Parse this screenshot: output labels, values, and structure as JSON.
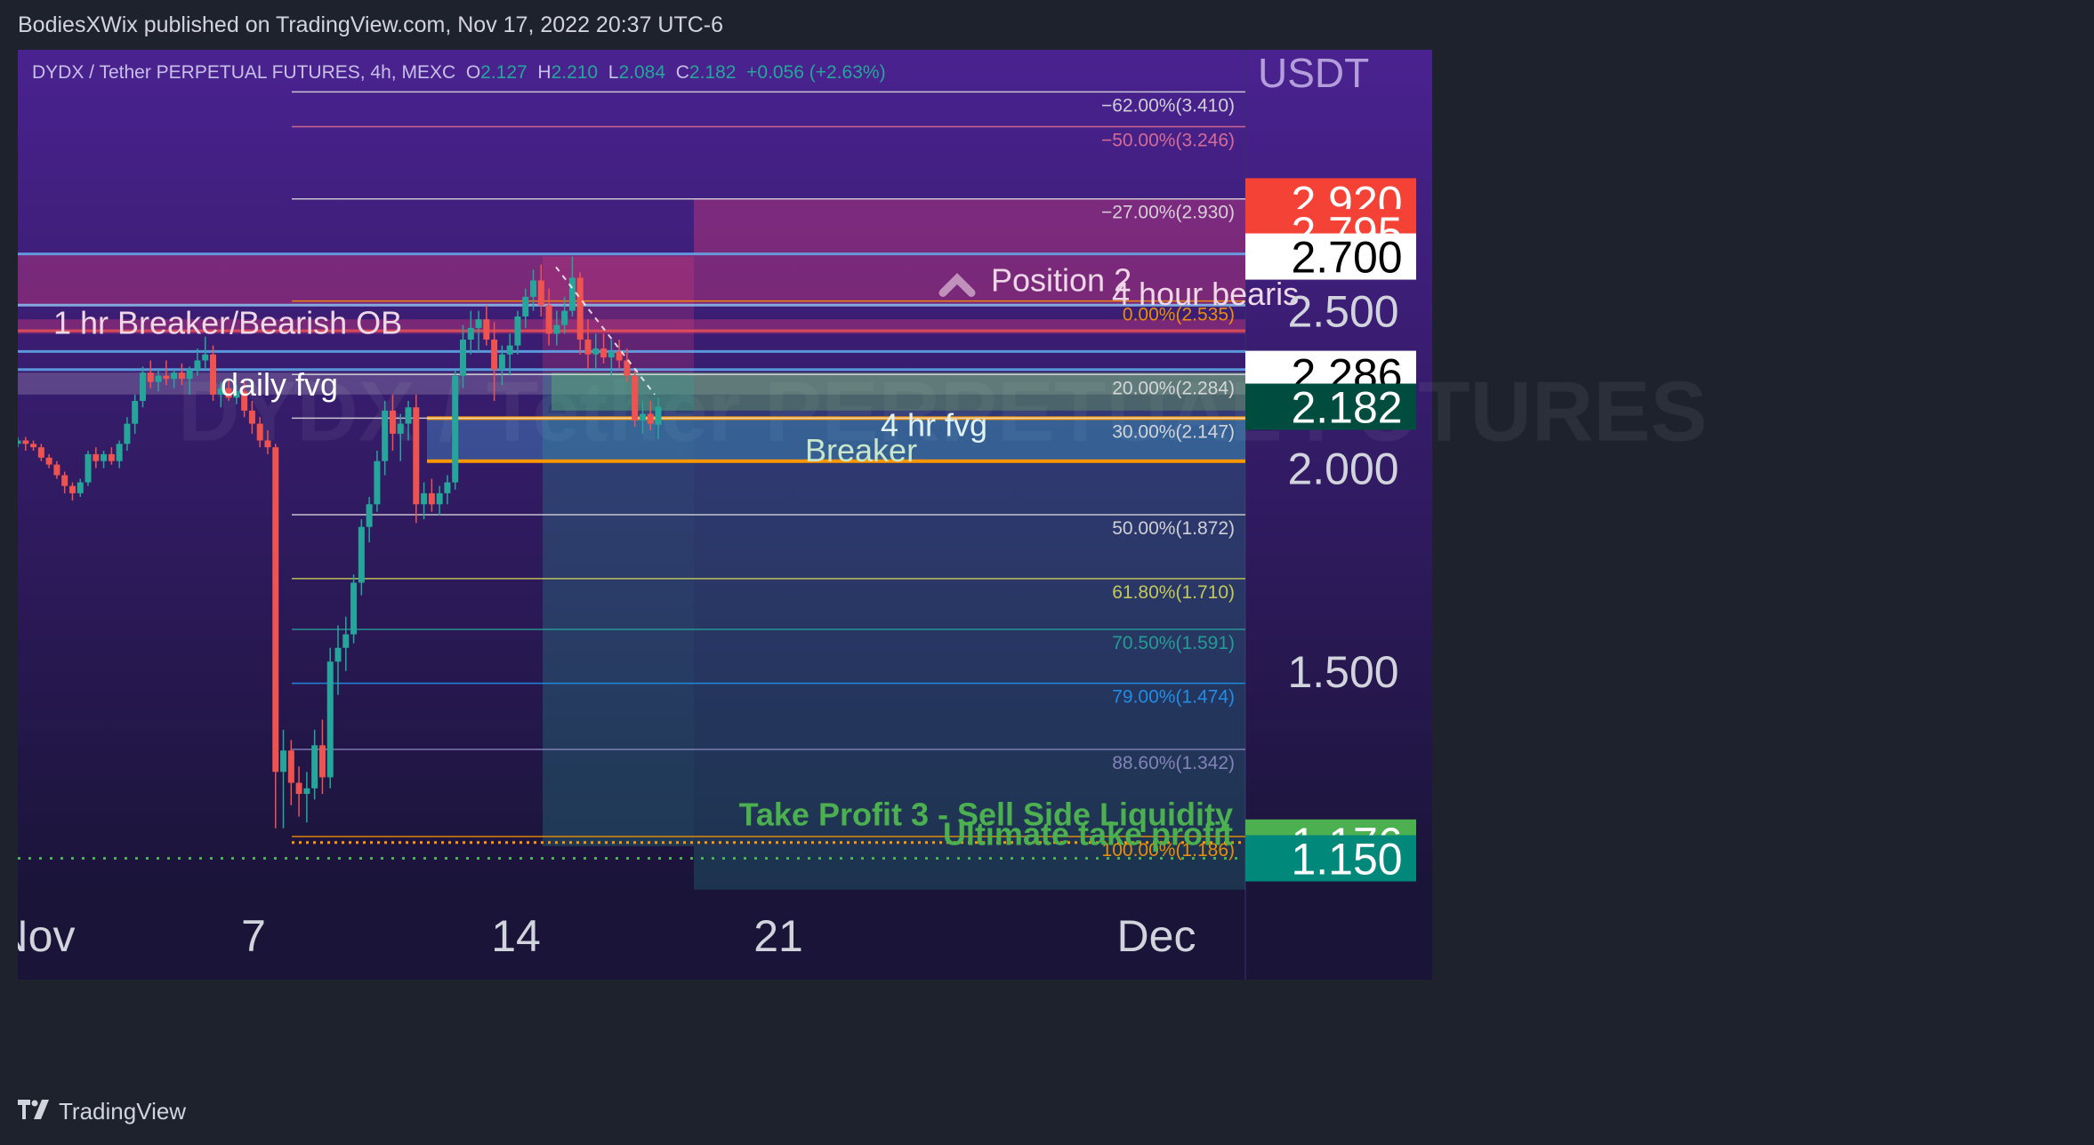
{
  "header": {
    "publisher": "BodiesXWix published on TradingView.com, Nov 17, 2022 20:37 UTC-6"
  },
  "symbol": {
    "name": "DYDX / Tether PERPETUAL FUTURES, 4h, MEXC",
    "o_label": "O",
    "o": "2.127",
    "h_label": "H",
    "h": "2.210",
    "l_label": "L",
    "l": "2.084",
    "c_label": "C",
    "c": "2.182",
    "change": "+0.056 (+2.63%)",
    "watermark": "DYDX / Tether PERPETUAL FUTURES"
  },
  "footer": {
    "brand": "TradingView",
    "logo": "tradingview-logo-icon"
  },
  "colors": {
    "background_top": "#4a2290",
    "background_bottom": "#1a1438",
    "up": "#26a69a",
    "down": "#ef5350",
    "fib_line": "#ffffff"
  },
  "chart_data": {
    "type": "candlestick",
    "currency_label": "USDT",
    "y_axis": {
      "scale": "log",
      "range": [
        1.09,
        3.62
      ],
      "tick_labels": [
        "2.500",
        "2.000",
        "1.500"
      ]
    },
    "x_axis": {
      "tick_labels": [
        "Nov",
        "7",
        "14",
        "21",
        "Dec"
      ]
    },
    "price_labels": [
      {
        "value": "2.920",
        "color": "#f44336",
        "text_color": "#ffffff"
      },
      {
        "value": "2.795",
        "color": "#f44336",
        "text_color": "#ffffff"
      },
      {
        "value": "2.700",
        "color": "#ffffff",
        "text_color": "#000000"
      },
      {
        "value": "2.286",
        "color": "#ffffff",
        "text_color": "#000000"
      },
      {
        "value": "2.182",
        "color": "#004d40",
        "text_color": "#ffffff"
      },
      {
        "value": "1.176",
        "color": "#4caf50",
        "text_color": "#ffffff"
      },
      {
        "value": "1.150",
        "color": "#00897b",
        "text_color": "#ffffff"
      }
    ],
    "fib_levels": [
      {
        "label": "−62.00%(3.410)",
        "price": 3.41,
        "color": "#e0e0e0"
      },
      {
        "label": "−50.00%(3.246)",
        "price": 3.246,
        "color": "#e57398"
      },
      {
        "label": "−27.00%(2.930)",
        "price": 2.93,
        "color": "#e0e0e0"
      },
      {
        "label": "0.00%(2.535)",
        "price": 2.535,
        "color": "#ff9800"
      },
      {
        "label": "20.00%(2.284)",
        "price": 2.284,
        "color": "#e0e0e0"
      },
      {
        "label": "30.00%(2.147)",
        "price": 2.147,
        "color": "#e0e0e0"
      },
      {
        "label": "50.00%(1.872)",
        "price": 1.872,
        "color": "#e0e0e0"
      },
      {
        "label": "61.80%(1.710)",
        "price": 1.71,
        "color": "#d4d85a"
      },
      {
        "label": "70.50%(1.591)",
        "price": 1.591,
        "color": "#26a69a"
      },
      {
        "label": "79.00%(1.474)",
        "price": 1.474,
        "color": "#2196f3"
      },
      {
        "label": "88.60%(1.342)",
        "price": 1.342,
        "color": "#8c8cbf"
      },
      {
        "label": "100.00%(1.186)",
        "price": 1.186,
        "color": "#ff9800"
      }
    ],
    "annotations": [
      {
        "text": "1 hr Breaker/Bearish OB",
        "color": "#f0d7e8"
      },
      {
        "text": "daily fvg",
        "color": "#ffffff"
      },
      {
        "text": "Position 2",
        "color": "#f0d7e8"
      },
      {
        "text": "4 hour bearis",
        "color": "#f0d7e8"
      },
      {
        "text": "4 hr fvg",
        "color": "#e0f2f1"
      },
      {
        "text": "Breaker",
        "color": "#c8e6c9"
      },
      {
        "text": "Take Profit 3 - Sell Side Liquidity",
        "color": "#4caf50"
      },
      {
        "text": "Ultimate take profit",
        "color": "#4caf50"
      }
    ],
    "candles": [
      [
        2.07,
        2.09,
        2.06,
        2.08
      ],
      [
        2.08,
        2.09,
        2.05,
        2.07
      ],
      [
        2.07,
        2.08,
        2.05,
        2.06
      ],
      [
        2.06,
        2.07,
        2.02,
        2.03
      ],
      [
        2.03,
        2.04,
        2.0,
        2.01
      ],
      [
        2.01,
        2.02,
        1.97,
        1.98
      ],
      [
        1.98,
        1.99,
        1.93,
        1.95
      ],
      [
        1.95,
        1.96,
        1.91,
        1.93
      ],
      [
        1.93,
        1.97,
        1.92,
        1.96
      ],
      [
        1.96,
        2.05,
        1.95,
        2.04
      ],
      [
        2.04,
        2.06,
        2.0,
        2.02
      ],
      [
        2.02,
        2.05,
        2.0,
        2.04
      ],
      [
        2.04,
        2.06,
        2.01,
        2.02
      ],
      [
        2.02,
        2.08,
        2.0,
        2.07
      ],
      [
        2.07,
        2.15,
        2.05,
        2.13
      ],
      [
        2.13,
        2.22,
        2.1,
        2.2
      ],
      [
        2.2,
        2.31,
        2.18,
        2.29
      ],
      [
        2.29,
        2.33,
        2.24,
        2.26
      ],
      [
        2.26,
        2.3,
        2.23,
        2.28
      ],
      [
        2.28,
        2.33,
        2.25,
        2.27
      ],
      [
        2.27,
        2.3,
        2.24,
        2.29
      ],
      [
        2.29,
        2.32,
        2.25,
        2.27
      ],
      [
        2.27,
        2.31,
        2.22,
        2.3
      ],
      [
        2.3,
        2.37,
        2.28,
        2.33
      ],
      [
        2.33,
        2.41,
        2.3,
        2.35
      ],
      [
        2.35,
        2.38,
        2.2,
        2.22
      ],
      [
        2.22,
        2.26,
        2.18,
        2.24
      ],
      [
        2.24,
        2.27,
        2.2,
        2.21
      ],
      [
        2.21,
        2.25,
        2.19,
        2.23
      ],
      [
        2.23,
        2.26,
        2.15,
        2.17
      ],
      [
        2.17,
        2.2,
        2.1,
        2.13
      ],
      [
        2.13,
        2.15,
        2.06,
        2.08
      ],
      [
        2.08,
        2.11,
        2.04,
        2.06
      ],
      [
        2.06,
        2.07,
        1.2,
        1.3
      ],
      [
        1.3,
        1.38,
        1.2,
        1.34
      ],
      [
        1.34,
        1.36,
        1.24,
        1.28
      ],
      [
        1.28,
        1.31,
        1.22,
        1.26
      ],
      [
        1.26,
        1.3,
        1.21,
        1.27
      ],
      [
        1.27,
        1.38,
        1.25,
        1.35
      ],
      [
        1.35,
        1.4,
        1.26,
        1.29
      ],
      [
        1.29,
        1.55,
        1.27,
        1.52
      ],
      [
        1.52,
        1.6,
        1.45,
        1.55
      ],
      [
        1.55,
        1.62,
        1.5,
        1.58
      ],
      [
        1.58,
        1.72,
        1.56,
        1.7
      ],
      [
        1.7,
        1.86,
        1.67,
        1.84
      ],
      [
        1.84,
        1.92,
        1.8,
        1.9
      ],
      [
        1.9,
        2.05,
        1.88,
        2.02
      ],
      [
        2.02,
        2.2,
        1.98,
        2.17
      ],
      [
        2.17,
        2.22,
        2.05,
        2.1
      ],
      [
        2.1,
        2.16,
        2.02,
        2.13
      ],
      [
        2.13,
        2.2,
        2.08,
        2.18
      ],
      [
        2.18,
        2.22,
        1.85,
        1.9
      ],
      [
        1.9,
        1.96,
        1.86,
        1.93
      ],
      [
        1.93,
        1.97,
        1.88,
        1.9
      ],
      [
        1.9,
        1.95,
        1.87,
        1.93
      ],
      [
        1.93,
        1.98,
        1.9,
        1.96
      ],
      [
        1.96,
        2.3,
        1.94,
        2.28
      ],
      [
        2.28,
        2.45,
        2.24,
        2.4
      ],
      [
        2.4,
        2.5,
        2.35,
        2.44
      ],
      [
        2.44,
        2.5,
        2.36,
        2.47
      ],
      [
        2.47,
        2.52,
        2.38,
        2.4
      ],
      [
        2.4,
        2.46,
        2.2,
        2.3
      ],
      [
        2.3,
        2.38,
        2.25,
        2.35
      ],
      [
        2.35,
        2.42,
        2.28,
        2.38
      ],
      [
        2.38,
        2.5,
        2.35,
        2.48
      ],
      [
        2.48,
        2.58,
        2.44,
        2.55
      ],
      [
        2.55,
        2.65,
        2.5,
        2.61
      ],
      [
        2.61,
        2.67,
        2.48,
        2.52
      ],
      [
        2.52,
        2.58,
        2.38,
        2.42
      ],
      [
        2.42,
        2.5,
        2.38,
        2.45
      ],
      [
        2.45,
        2.55,
        2.42,
        2.5
      ],
      [
        2.5,
        2.7,
        2.48,
        2.62
      ],
      [
        2.62,
        2.64,
        2.35,
        2.4
      ],
      [
        2.4,
        2.47,
        2.3,
        2.35
      ],
      [
        2.35,
        2.42,
        2.3,
        2.37
      ],
      [
        2.37,
        2.42,
        2.32,
        2.34
      ],
      [
        2.34,
        2.4,
        2.28,
        2.36
      ],
      [
        2.36,
        2.4,
        2.3,
        2.33
      ],
      [
        2.33,
        2.37,
        2.26,
        2.28
      ],
      [
        2.28,
        2.3,
        2.12,
        2.14
      ],
      [
        2.14,
        2.2,
        2.1,
        2.16
      ],
      [
        2.16,
        2.2,
        2.11,
        2.13
      ],
      [
        2.127,
        2.21,
        2.084,
        2.182
      ]
    ]
  }
}
